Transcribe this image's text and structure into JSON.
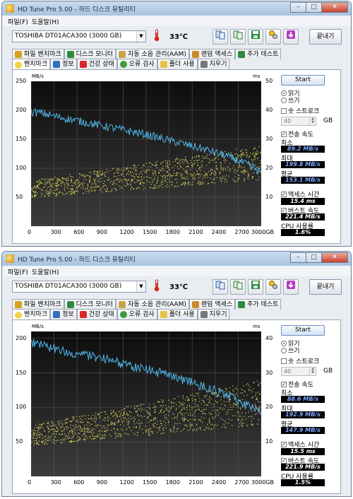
{
  "windows": [
    {
      "title": "HD Tune Pro 5.00 - 하드 디스크 유틸리티",
      "menu": [
        "파일(F)",
        "도움말(H)"
      ],
      "drive": "TOSHIBA DT01ACA300 (3000 GB)",
      "temperature": "33℃",
      "quit_label": "끝내기",
      "tabs_top": [
        "파일 벤치마크",
        "디스크 모니터",
        "자동 소음 관리(AAM)",
        "랜덤 액세스",
        "추가 테스트"
      ],
      "tabs_bottom": [
        "벤치마크",
        "정보",
        "건강 상태",
        "오류 검사",
        "폴더 사용",
        "지우기"
      ],
      "active_tab": "벤치마크",
      "start_label": "Start",
      "mode_read": "읽기",
      "mode_write": "쓰기",
      "short_stroke_label": "숏 스트로크",
      "short_stroke_value": "40",
      "short_stroke_unit": "GB",
      "transfer_rate_label": "전송 속도",
      "min_label": "최소",
      "min_value": "89.2 MB/s",
      "max_label": "최대",
      "max_value": "199.8 MB/s",
      "avg_label": "평균",
      "avg_value": "153.1 MB/s",
      "access_time_label": "액세스 시간",
      "access_time_value": "15.4 ms",
      "burst_rate_label": "버스트 속도",
      "burst_rate_value": "221.4 MB/s",
      "cpu_label": "CPU 사용률",
      "cpu_value": "1.6%",
      "chart_data": {
        "type": "line",
        "ylabel": "MB/s",
        "y2label": "ms",
        "x_ticks": [
          "0",
          "300",
          "600",
          "900",
          "1200",
          "1500",
          "1800",
          "2100",
          "2400",
          "2700",
          "3000GB"
        ],
        "y_ticks_left": [
          "250",
          "200",
          "150",
          "100",
          "50"
        ],
        "y_ticks_right": [
          "50",
          "40",
          "30",
          "20",
          "10"
        ],
        "xlim": [
          0,
          3000
        ],
        "ylim": [
          0,
          250
        ],
        "y2lim": [
          0,
          50
        ],
        "transfer_series": [
          [
            0,
            197
          ],
          [
            150,
            195
          ],
          [
            300,
            190
          ],
          [
            450,
            186
          ],
          [
            600,
            182
          ],
          [
            750,
            178
          ],
          [
            900,
            174
          ],
          [
            1050,
            170
          ],
          [
            1200,
            166
          ],
          [
            1350,
            162
          ],
          [
            1500,
            158
          ],
          [
            1650,
            153
          ],
          [
            1800,
            148
          ],
          [
            1950,
            143
          ],
          [
            2100,
            138
          ],
          [
            2250,
            133
          ],
          [
            2400,
            127
          ],
          [
            2550,
            121
          ],
          [
            2700,
            113
          ],
          [
            2850,
            104
          ],
          [
            3000,
            93
          ]
        ],
        "access_scatter_range_ms": [
          10,
          22
        ],
        "access_color": "#d8d55a",
        "transfer_color": "#4fb4e6"
      }
    },
    {
      "title": "HD Tune Pro 5.00 - 하드 디스크 유틸리티",
      "menu": [
        "파일(F)",
        "도움말(H)"
      ],
      "drive": "TOSHIBA DT01ACA300 (3000 GB)",
      "temperature": "33℃",
      "quit_label": "끝내기",
      "tabs_top": [
        "파일 벤치마크",
        "디스크 모니터",
        "자동 소음 관리(AAM)",
        "랜덤 액세스",
        "추가 테스트"
      ],
      "tabs_bottom": [
        "벤치마크",
        "정보",
        "건강 상태",
        "오류 검사",
        "폴더 사용",
        "지우기"
      ],
      "active_tab": "벤치마크",
      "start_label": "Start",
      "mode_read": "읽기",
      "mode_write": "쓰기",
      "short_stroke_label": "숏 스트로크",
      "short_stroke_value": "40",
      "short_stroke_unit": "GB",
      "transfer_rate_label": "전송 속도",
      "min_label": "최소",
      "min_value": "88.6 MB/s",
      "max_label": "최대",
      "max_value": "192.9 MB/s",
      "avg_label": "평균",
      "avg_value": "147.9 MB/s",
      "access_time_label": "액세스 시간",
      "access_time_value": "15.5 ms",
      "burst_rate_label": "버스트 속도",
      "burst_rate_value": "221.9 MB/s",
      "cpu_label": "CPU 사용률",
      "cpu_value": "1.5%",
      "chart_data": {
        "type": "line",
        "ylabel": "MB/s",
        "y2label": "ms",
        "x_ticks": [
          "0",
          "300",
          "600",
          "900",
          "1200",
          "1500",
          "1800",
          "2100",
          "2400",
          "2700",
          "3000GB"
        ],
        "y_ticks_left": [
          "200",
          "150",
          "100",
          "50"
        ],
        "y_ticks_right": [
          "40",
          "30",
          "20",
          "10"
        ],
        "xlim": [
          0,
          3000
        ],
        "ylim": [
          0,
          210
        ],
        "y2lim": [
          0,
          42
        ],
        "transfer_series": [
          [
            0,
            194
          ],
          [
            150,
            190
          ],
          [
            300,
            186
          ],
          [
            450,
            182
          ],
          [
            600,
            178
          ],
          [
            750,
            175
          ],
          [
            900,
            171
          ],
          [
            1050,
            167
          ],
          [
            1200,
            163
          ],
          [
            1350,
            159
          ],
          [
            1500,
            155
          ],
          [
            1650,
            151
          ],
          [
            1800,
            146
          ],
          [
            1950,
            141
          ],
          [
            2100,
            136
          ],
          [
            2250,
            130
          ],
          [
            2400,
            124
          ],
          [
            2550,
            117
          ],
          [
            2700,
            109
          ],
          [
            2850,
            100
          ],
          [
            3000,
            92
          ]
        ],
        "access_scatter_range_ms": [
          9,
          22
        ],
        "access_color": "#d8d55a",
        "transfer_color": "#4fb4e6"
      }
    }
  ]
}
